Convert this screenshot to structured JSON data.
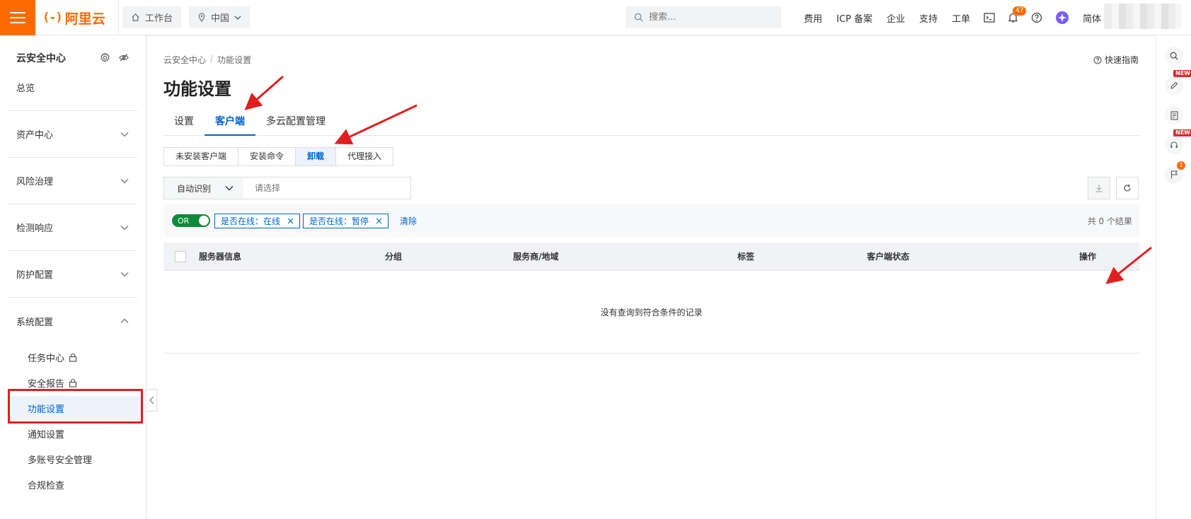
{
  "topbar": {
    "logo_text": "阿里云",
    "logo_mark": "(-)",
    "workbench": "工作台",
    "region": "中国",
    "search_placeholder": "搜索...",
    "links": [
      "费用",
      "ICP 备案",
      "企业",
      "支持",
      "工单"
    ],
    "notification_count": "47",
    "language": "简体",
    "brand_color": "#ff6a00"
  },
  "sidebar": {
    "title": "云安全中心",
    "overview": "总览",
    "groups": [
      "资产中心",
      "风险治理",
      "检测响应",
      "防护配置",
      "系统配置"
    ],
    "sub_items": [
      "任务中心",
      "安全报告",
      "功能设置",
      "通知设置",
      "多账号安全管理",
      "合规检查"
    ],
    "active_sub": "功能设置"
  },
  "main": {
    "breadcrumb": [
      "云安全中心",
      "功能设置"
    ],
    "quick_guide": "快速指南",
    "title": "功能设置",
    "tabs": [
      "设置",
      "客户端",
      "多云配置管理"
    ],
    "active_tab": "客户端",
    "segments": [
      "未安装客户端",
      "安装命令",
      "卸载",
      "代理接入"
    ],
    "active_segment": "卸载",
    "filter": {
      "select": "自动识别",
      "placeholder": "请选择"
    },
    "tag_bar": {
      "logic": "OR",
      "tags": [
        "是否在线：在线",
        "是否在线：暂停"
      ],
      "clear": "清除",
      "result": "共 0 个结果"
    },
    "table": {
      "columns": [
        "服务器信息",
        "分组",
        "服务商/地域",
        "标签",
        "客户端状态",
        "操作"
      ],
      "empty": "没有查询到符合条件的记录"
    },
    "accent_color": "#0064c8"
  },
  "rail": {
    "new_label": "NEW",
    "flag_count": "1"
  }
}
